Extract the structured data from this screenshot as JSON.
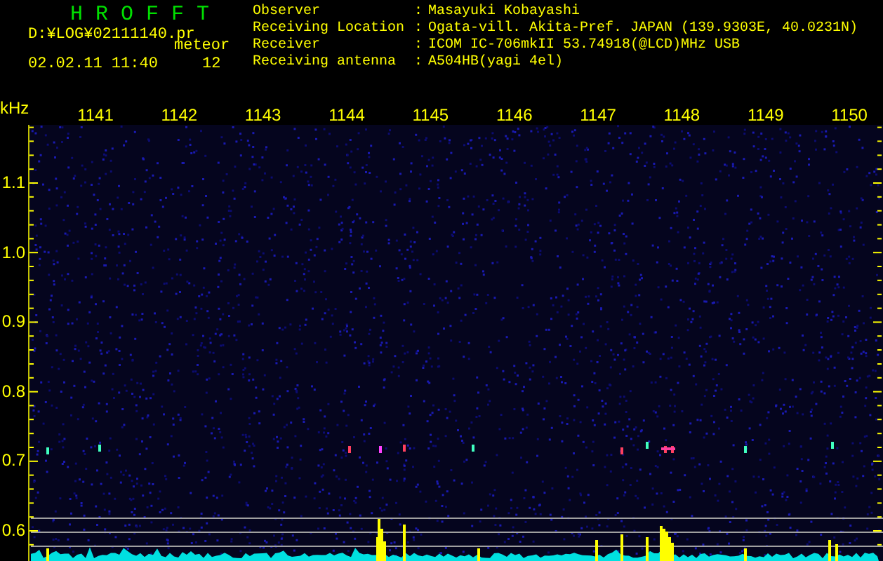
{
  "app_title": "H R O F F T",
  "file_path": "D:¥LOG¥02111140.pr",
  "mode_label": "meteor",
  "timestamp": "02.02.11 11:40",
  "count": "12",
  "info": [
    {
      "label": "Observer",
      "separator": ":",
      "value": "Masayuki Kobayashi"
    },
    {
      "label": "Receiving Location",
      "separator": ":",
      "value": "Ogata-vill. Akita-Pref. JAPAN (139.9303E, 40.0231N)"
    },
    {
      "label": "Receiver",
      "separator": ":",
      "value": "ICOM IC-706mkII 53.74918(@LCD)MHz USB"
    },
    {
      "label": "Receiving antenna",
      "separator": ":",
      "value": "A504HB(yagi 4el)"
    }
  ],
  "axis": {
    "unit": "kHz",
    "x_labels": [
      "1141",
      "1142",
      "1143",
      "1144",
      "1145",
      "1146",
      "1147",
      "1148",
      "1149",
      "1150"
    ],
    "y_labels": [
      "1.1",
      "1.0",
      "0.9",
      "0.8",
      "0.7",
      "0.6"
    ]
  }
}
